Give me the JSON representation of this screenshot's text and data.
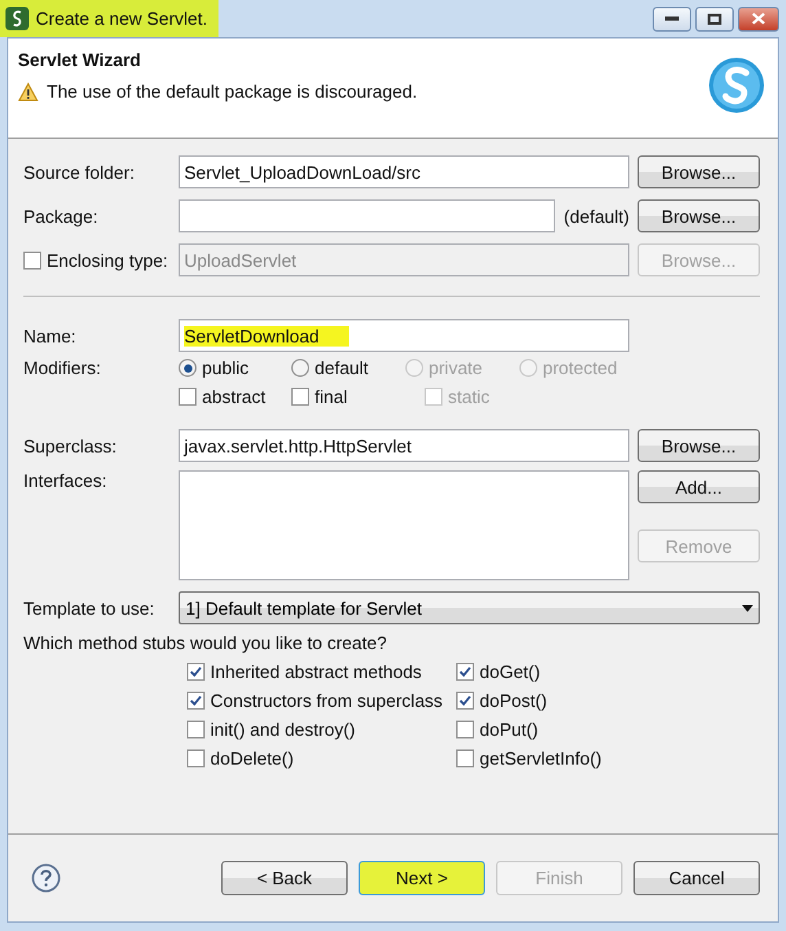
{
  "window": {
    "title": "Create a new Servlet.",
    "highlighted": true
  },
  "header": {
    "title": "Servlet Wizard",
    "message": "The use of the default package is discouraged."
  },
  "source_folder": {
    "label": "Source folder:",
    "value": "Servlet_UploadDownLoad/src",
    "button": "Browse..."
  },
  "package": {
    "label": "Package:",
    "suffix": "(default)",
    "button": "Browse..."
  },
  "enclosing_type": {
    "label": "Enclosing type:",
    "checked": false,
    "value": "UploadServlet",
    "disabled": true,
    "button": "Browse..."
  },
  "name": {
    "label": "Name:",
    "value": "ServletDownload",
    "highlighted": true
  },
  "modifiers": {
    "label": "Modifiers:",
    "radios": [
      {
        "label": "public",
        "selected": true,
        "disabled": false
      },
      {
        "label": "default",
        "selected": false,
        "disabled": false
      },
      {
        "label": "private",
        "selected": false,
        "disabled": true
      },
      {
        "label": "protected",
        "selected": false,
        "disabled": true
      }
    ],
    "checkboxes": [
      {
        "label": "abstract",
        "checked": false,
        "disabled": false
      },
      {
        "label": "final",
        "checked": false,
        "disabled": false
      },
      {
        "label": "static",
        "checked": false,
        "disabled": true
      }
    ]
  },
  "superclass": {
    "label": "Superclass:",
    "value": "javax.servlet.http.HttpServlet",
    "button": "Browse..."
  },
  "interfaces": {
    "label": "Interfaces:",
    "buttons": [
      {
        "label": "Add...",
        "disabled": false
      },
      {
        "label": "Remove",
        "disabled": true
      }
    ]
  },
  "template": {
    "label": "Template to use:",
    "value": "1] Default template for Servlet"
  },
  "method_stubs": {
    "question": "Which method stubs would you like to create?",
    "items": [
      {
        "label": "Inherited abstract methods",
        "checked": true
      },
      {
        "label": "doGet()",
        "checked": true
      },
      {
        "label": "Constructors from superclass",
        "checked": true
      },
      {
        "label": "doPost()",
        "checked": true
      },
      {
        "label": "init() and destroy()",
        "checked": false
      },
      {
        "label": "doPut()",
        "checked": false
      },
      {
        "label": "doDelete()",
        "checked": false
      },
      {
        "label": "getServletInfo()",
        "checked": false
      }
    ]
  },
  "footer_buttons": [
    {
      "label": "< Back",
      "disabled": false,
      "highlighted": false
    },
    {
      "label": "Next >",
      "disabled": false,
      "highlighted": true
    },
    {
      "label": "Finish",
      "disabled": true,
      "highlighted": false
    },
    {
      "label": "Cancel",
      "disabled": false,
      "highlighted": false
    }
  ]
}
